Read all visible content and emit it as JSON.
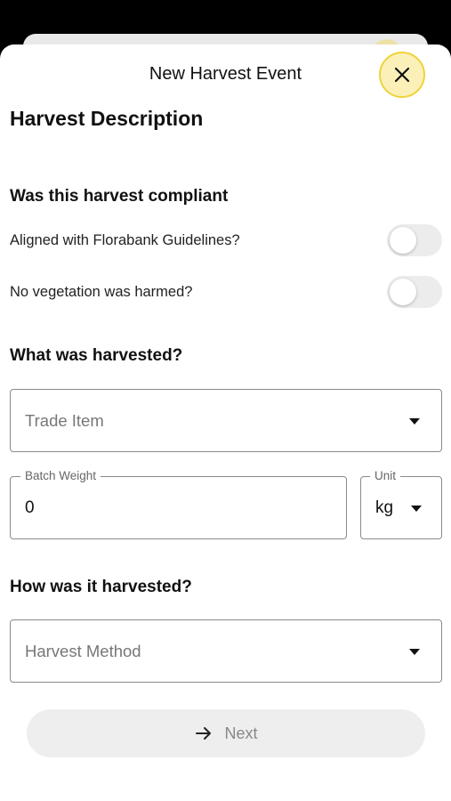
{
  "header": {
    "title": "New Harvest Event",
    "close_icon": "close-icon"
  },
  "section_title": "Harvest Description",
  "compliance": {
    "heading": "Was this harvest compliant",
    "items": [
      {
        "label": "Aligned with Florabank Guidelines?",
        "checked": false
      },
      {
        "label": "No vegetation was harmed?",
        "checked": false
      }
    ]
  },
  "harvested": {
    "heading": "What was harvested?",
    "trade_item_placeholder": "Trade Item",
    "batch_weight_label": "Batch Weight",
    "batch_weight_value": "0",
    "unit_label": "Unit",
    "unit_value": "kg"
  },
  "method": {
    "heading": "How was it harvested?",
    "placeholder": "Harvest Method"
  },
  "footer": {
    "next_label": "Next",
    "next_icon": "arrow-right-icon"
  },
  "colors": {
    "accent": "#efd33a",
    "accent_bg": "#fbf1b8"
  }
}
